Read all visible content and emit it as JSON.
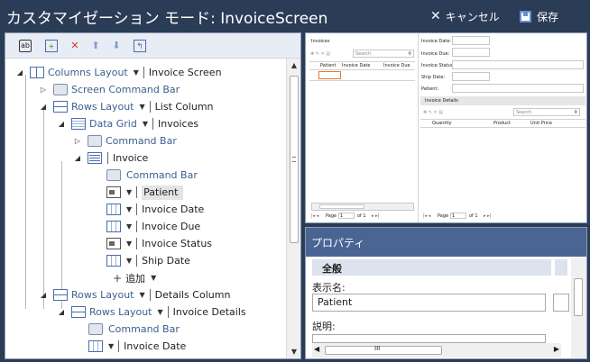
{
  "window": {
    "title": "カスタマイゼーション モード: InvoiceScreen",
    "cancel_label": "キャンセル",
    "save_label": "保存"
  },
  "toolbar": {
    "icons": [
      "add-field-icon",
      "add-layout-icon",
      "delete-icon",
      "move-up-icon",
      "move-down-icon",
      "reset-icon"
    ]
  },
  "tree": {
    "columns_layout": "Columns Layout",
    "invoice_screen": "Invoice Screen",
    "screen_command_bar": "Screen Command Bar",
    "rows_layout_1": "Rows Layout",
    "list_column": "List Column",
    "data_grid": "Data Grid",
    "invoices": "Invoices",
    "command_bar_1": "Command Bar",
    "invoice": "Invoice",
    "command_bar_2": "Command Bar",
    "patient": "Patient",
    "invoice_date": "Invoice Date",
    "invoice_due": "Invoice Due",
    "invoice_status": "Invoice Status",
    "ship_date": "Ship Date",
    "add": "追加",
    "rows_layout_2": "Rows Layout",
    "details_column": "Details Column",
    "rows_layout_3": "Rows Layout",
    "invoice_details": "Invoice Details",
    "command_bar_3": "Command Bar",
    "invoice_date_2": "Invoice Date"
  },
  "preview": {
    "grid_title": "Invoices",
    "search_placeholder": "Search",
    "columns": [
      "Patient",
      "Invoice Date",
      "Invoice Due"
    ],
    "page_label": "Page",
    "page_value": "1",
    "of_label": "of 1",
    "fields": [
      "Invoice Date:",
      "Invoice Due:",
      "Invoice Status:",
      "Ship Date:",
      "Patient:"
    ],
    "details_title": "Invoice Details",
    "details_columns": [
      "Quantity",
      "Product",
      "Unit Price"
    ]
  },
  "properties": {
    "header": "プロパティ",
    "group": "全般",
    "display_name_label": "表示名:",
    "display_name_value": "Patient",
    "description_label": "説明:",
    "scroll_grip": "III"
  }
}
